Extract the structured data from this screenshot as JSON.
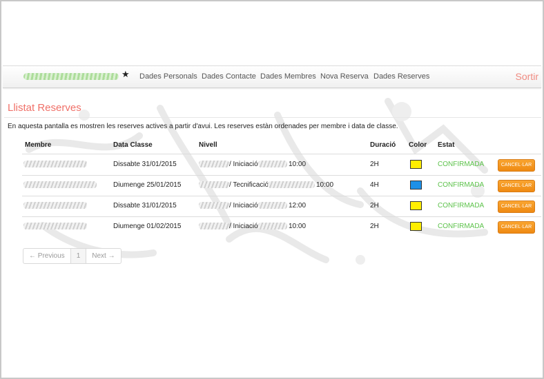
{
  "nav": {
    "star": "★",
    "items": [
      "Dades Personals",
      "Dades Contacte",
      "Dades Membres",
      "Nova Reserva",
      "Dades Reserves"
    ],
    "logout": "Sortir"
  },
  "page": {
    "title": "Llistat Reserves",
    "description": "En aquesta pantalla es mostren les reserves actives a partir d'avui. Les reserves estàn ordenades per membre i data de classe."
  },
  "table": {
    "headers": [
      "Membre",
      "Data Classe",
      "Nivell",
      "Duració",
      "Color",
      "Estat"
    ],
    "rows": [
      {
        "date": "Dissabte 31/01/2015",
        "level": "/ Iniciació",
        "time": "10:00",
        "duration": "2H",
        "color": "#ffee00",
        "status": "CONFIRMADA",
        "action": "CANCEL·LAR"
      },
      {
        "date": "Diumenge 25/01/2015",
        "level": "/ Tecnificació",
        "time": "10:00",
        "duration": "4H",
        "color": "#1e90e8",
        "status": "CONFIRMADA",
        "action": "CANCEL·LAR"
      },
      {
        "date": "Dissabte 31/01/2015",
        "level": "/ Iniciació",
        "time": "12:00",
        "duration": "2H",
        "color": "#ffee00",
        "status": "CONFIRMADA",
        "action": "CANCEL·LAR"
      },
      {
        "date": "Diumenge 01/02/2015",
        "level": "/ Iniciació",
        "time": "10:00",
        "duration": "2H",
        "color": "#ffee00",
        "status": "CONFIRMADA",
        "action": "CANCEL·LAR"
      }
    ]
  },
  "pagination": {
    "previous": "← Previous",
    "current": "1",
    "next": "Next →"
  }
}
